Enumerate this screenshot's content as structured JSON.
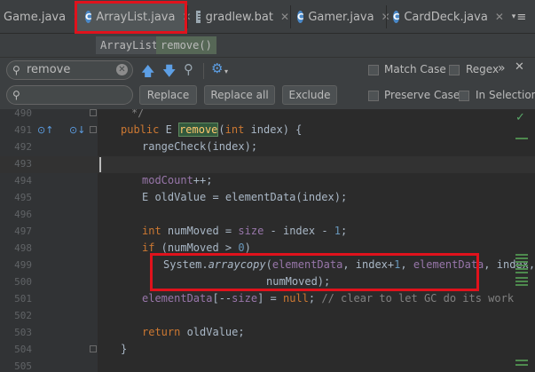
{
  "tabs": [
    {
      "label": "Game.java",
      "icon": "class-icon"
    },
    {
      "label": "ArrayList.java",
      "icon": "class-icon",
      "active": true
    },
    {
      "label": "gradlew.bat",
      "icon": "file-icon"
    },
    {
      "label": "Gamer.java",
      "icon": "class-icon"
    },
    {
      "label": "CardDeck.java",
      "icon": "class-icon"
    }
  ],
  "tab_overflow": "≡",
  "breadcrumb": {
    "class": "ArrayList",
    "method": "remove()"
  },
  "find": {
    "search_value": "remove",
    "replace_value": "",
    "replace_label": "Replace",
    "replace_all_label": "Replace all",
    "exclude_label": "Exclude",
    "match_case": "Match Case",
    "regex": "Regex",
    "more": "»",
    "preserve_case": "Preserve Case",
    "in_selection": "In Selection"
  },
  "line_numbers": [
    "490",
    "491",
    "492",
    "493",
    "494",
    "495",
    "496",
    "497",
    "498",
    "499",
    "500",
    "501",
    "502",
    "503",
    "504",
    "505"
  ],
  "code": {
    "l490": "*/",
    "l491_kw": "public",
    "l491_type": "E",
    "l491_name": "remove",
    "l491_paren": "(",
    "l491_ptype": "int",
    "l491_rest": " index) {",
    "l492": "rangeCheck(index);",
    "l494_fld": "modCount",
    "l494_rest": "++;",
    "l495_type": "E",
    "l495_rest": " oldValue = elementData(index);",
    "l497_kw": "int",
    "l497_mid": " numMoved = ",
    "l497_fld": "size",
    "l497_rest": " - index - ",
    "l497_num": "1",
    "l497_end": ";",
    "l498_kw": "if",
    "l498_rest": " (numMoved > ",
    "l498_num": "0",
    "l498_end": ")",
    "l499_a": "System.",
    "l499_m": "arraycopy",
    "l499_b": "(",
    "l499_f1": "elementData",
    "l499_c": ", index+",
    "l499_n1": "1",
    "l499_d": ", ",
    "l499_f2": "elementData",
    "l499_e": ", index,",
    "l500": "numMoved);",
    "l501_fld": "elementData",
    "l501_a": "[--",
    "l501_fld2": "size",
    "l501_b": "] = ",
    "l501_kw": "null",
    "l501_c": "; ",
    "l501_cmt": "// clear to let GC do its work",
    "l503_kw": "return",
    "l503_rest": " oldValue;",
    "l504": "}"
  },
  "colors": {
    "highlight_box": "#e0121c",
    "match_highlight": "#32593d"
  }
}
